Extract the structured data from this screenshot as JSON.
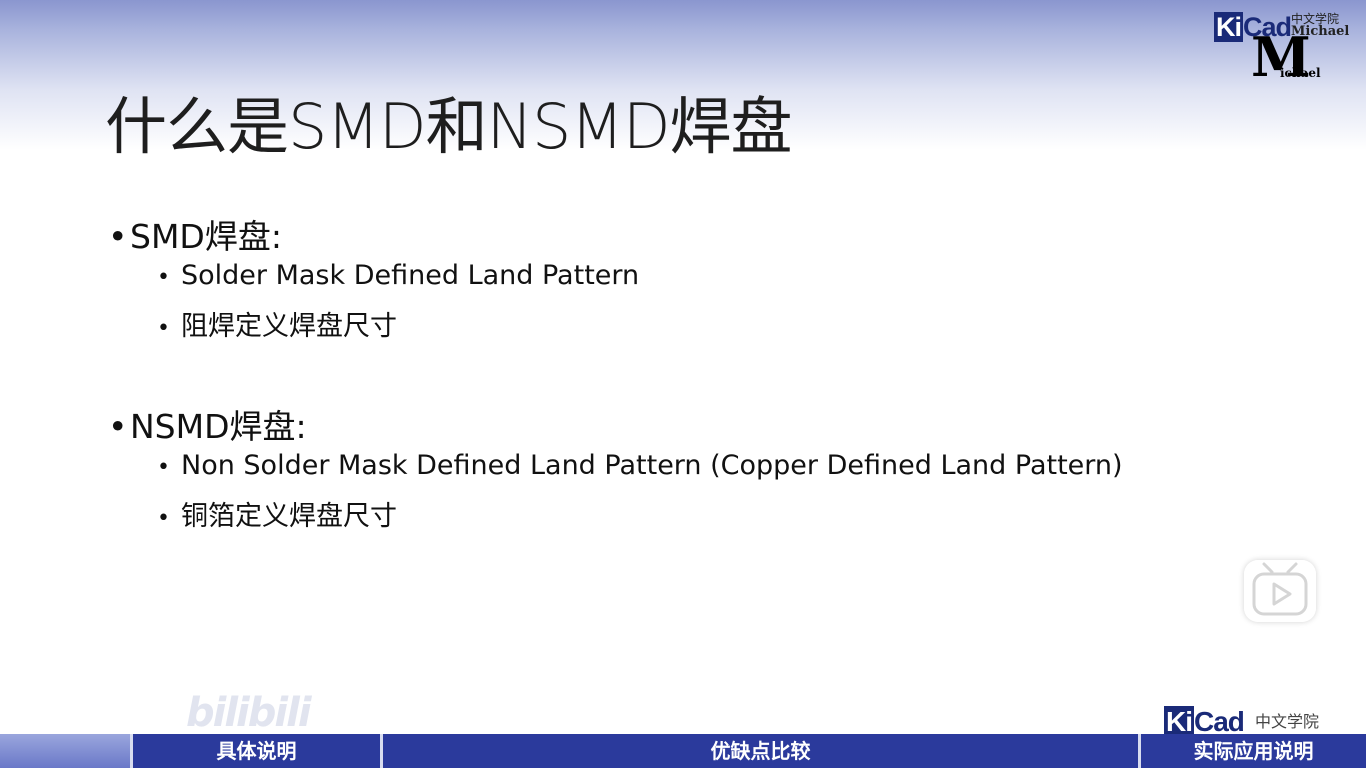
{
  "slide": {
    "title": "什么是SMD和NSMD焊盘",
    "sections": [
      {
        "heading": "SMD焊盘:",
        "items": [
          "Solder Mask Defined Land Pattern",
          "阻焊定义焊盘尺寸"
        ]
      },
      {
        "heading": "NSMD焊盘:",
        "items": [
          "Non Solder Mask Defined Land Pattern (Copper Defined Land Pattern)",
          "铜箔定义焊盘尺寸"
        ]
      }
    ],
    "bullet_glyph": "•"
  },
  "logo": {
    "kicad_ki": "Ki",
    "kicad_rest": "Cad",
    "cn": "中文学院",
    "sub": "Michael",
    "m": "M",
    "m_sub": "ichael"
  },
  "watermark": {
    "bilibili": "bilibili",
    "play_icon": "play-icon"
  },
  "navbar": {
    "tabs": [
      "具体说明",
      "优缺点比较",
      "实际应用说明"
    ],
    "color": "#2b3a9c"
  },
  "logo_bottom": {
    "kicad_ki": "Ki",
    "kicad_rest": "Cad",
    "cn": "中文学院"
  }
}
